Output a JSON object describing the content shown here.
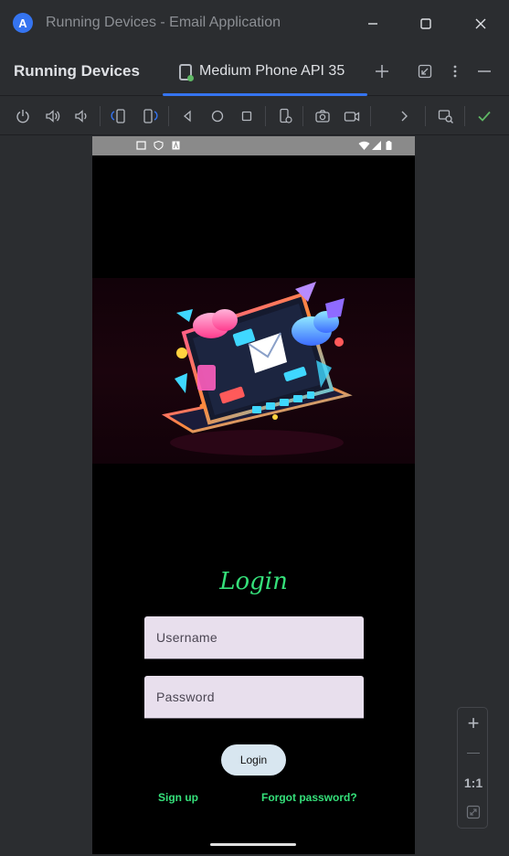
{
  "window": {
    "title": "Running Devices - Email Application",
    "logo_letter": "A"
  },
  "panel": {
    "title": "Running Devices",
    "tab_label": "Medium Phone API 35"
  },
  "colors": {
    "accent": "#3574f0",
    "login_green": "#35e07a",
    "field_bg": "#e8dfed",
    "button_bg": "#d8e6f0"
  },
  "app": {
    "login_title": "Login",
    "username_placeholder": "Username",
    "password_placeholder": "Password",
    "login_button": "Login",
    "signup_link": "Sign up",
    "forgot_link": "Forgot password?"
  },
  "zoom": {
    "plus": "+",
    "minus": "—",
    "ratio": "1:1"
  }
}
